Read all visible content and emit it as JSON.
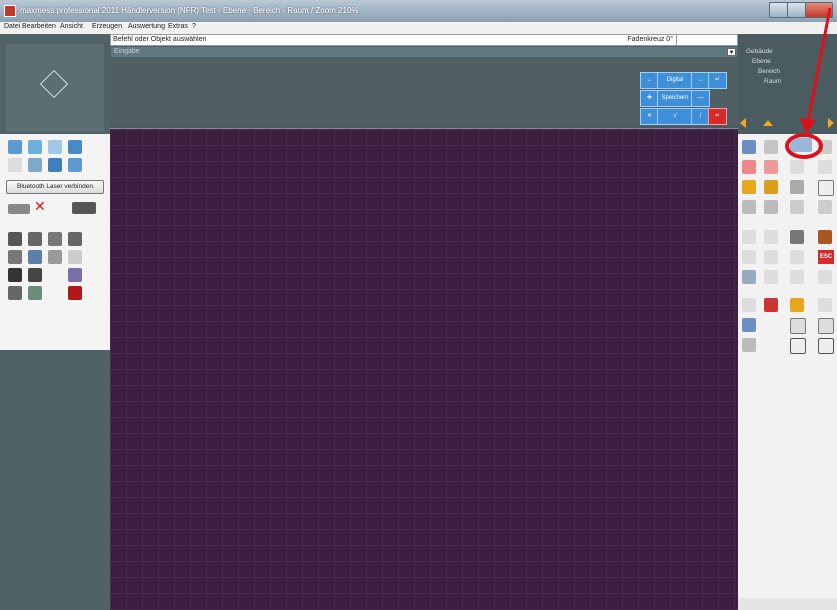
{
  "window": {
    "title": "maxmess professional 2011 Händlerversion (NFR)  Test - Ebene - Bereich - Raum / Zoom 210%"
  },
  "menu": {
    "items": [
      "Datei",
      "Bearbeiten",
      "Ansicht",
      "Erzeugen",
      "Auswertung",
      "Extras",
      "?"
    ]
  },
  "command": {
    "prompt": "Befehl oder Objekt auswählen",
    "crosshair": "Fadenkreuz 0°"
  },
  "input": {
    "label": "Eingabe",
    "dropdown_symbol": "▼"
  },
  "keypad": {
    "keys": [
      "←",
      "Digital",
      "→",
      "↵",
      "✚",
      "Speichern",
      "—",
      "✕",
      "√",
      "/",
      "↵"
    ]
  },
  "left_panel": {
    "bluetooth_button": "Bluetooth Laser verbinden"
  },
  "tree": {
    "nodes": [
      "Gebäude",
      "Ebene",
      "Bereich",
      "Raum"
    ]
  },
  "right_tools": {
    "esc_label": "ESC"
  },
  "colors": {
    "canvas_bg": "#3c1e40",
    "key_blue": "#3f8fd8",
    "key_red": "#d42c2c",
    "annotation_red": "#e0101b",
    "nav_orange": "#f5a623"
  }
}
